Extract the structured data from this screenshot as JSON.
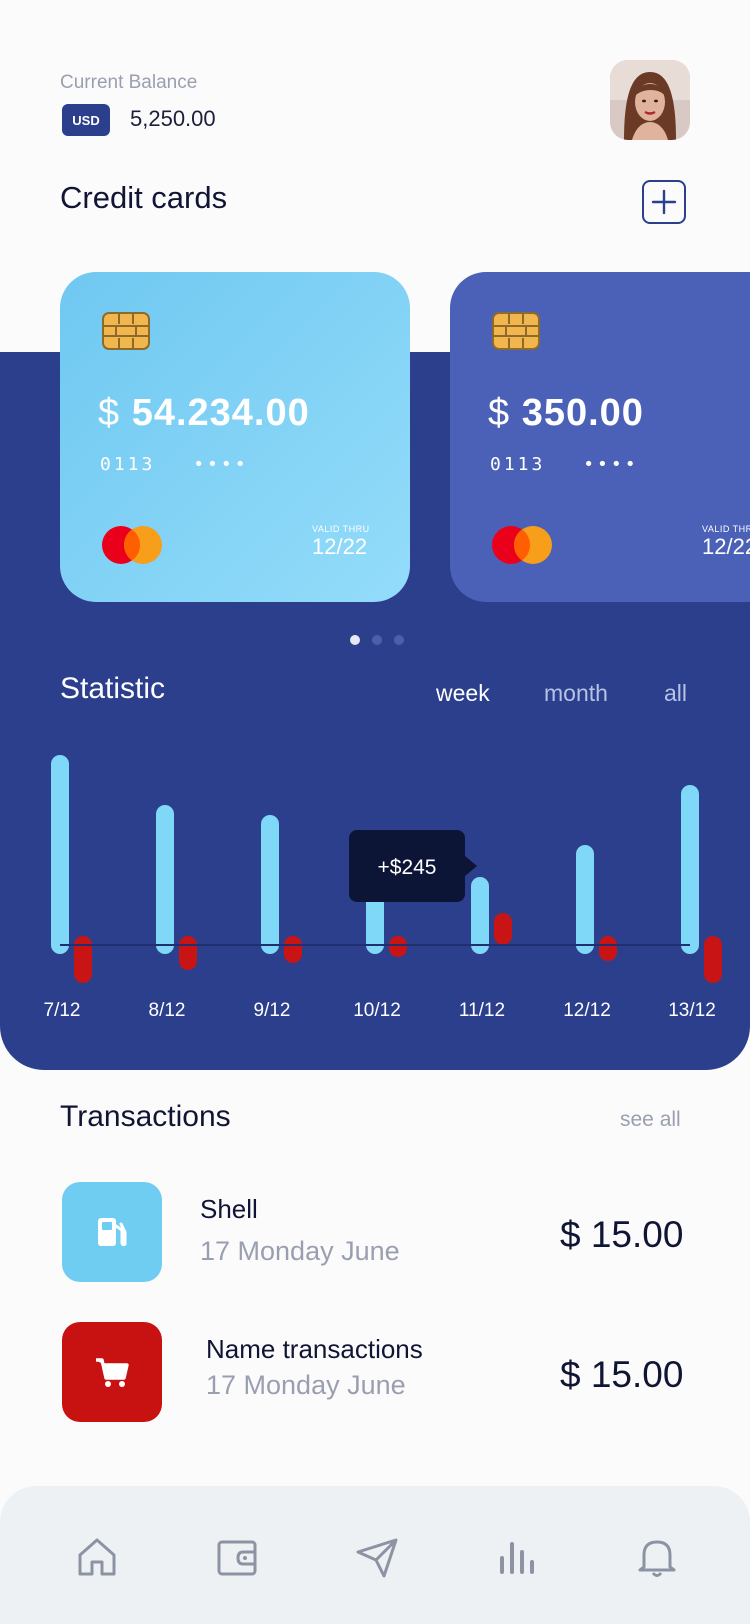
{
  "header": {
    "balance_label": "Current Balance",
    "currency": "USD",
    "balance": "5,250.00"
  },
  "cards_section": {
    "title": "Credit cards",
    "add_icon": "plus-icon"
  },
  "cards": [
    {
      "currency_symbol": "$",
      "amount": "54.234.00",
      "number_prefix": "0113",
      "number_mask": "••••",
      "valid_label": "VALID THRU",
      "valid_date": "12/22",
      "color": "#7ad1f5"
    },
    {
      "currency_symbol": "$",
      "amount": "350.00",
      "number_prefix": "0113",
      "number_mask": "••••",
      "valid_label": "VALID THRU",
      "valid_date": "12/22",
      "color": "#4b61b8"
    }
  ],
  "pagination": {
    "count": 3,
    "active": 0
  },
  "statistic": {
    "title": "Statistic",
    "tabs": [
      "week",
      "month",
      "all"
    ],
    "active_tab": "week",
    "tooltip": "+$245"
  },
  "chart_data": {
    "type": "bar",
    "categories": [
      "7/12",
      "8/12",
      "9/12",
      "10/12",
      "11/12",
      "12/12",
      "13/12"
    ],
    "series": [
      {
        "values": [
          190,
          140,
          130,
          110,
          68,
          100,
          160
        ],
        "color": "#7fd8f7"
      },
      {
        "values": [
          -38,
          -25,
          -18,
          -12,
          32,
          -16,
          -38
        ],
        "color": "#c81414"
      }
    ],
    "colors": {
      "positive": "#7fd8f7",
      "negative": "#c81414",
      "tooltip_bg": "#0c1536"
    }
  },
  "transactions": {
    "title": "Transactions",
    "see_all": "see all",
    "items": [
      {
        "name": "Shell",
        "date": "17 Monday June",
        "amount": "$ 15.00",
        "icon": "fuel-pump-icon",
        "color": "#6fcdf2"
      },
      {
        "name": "Name transactions",
        "date": "17 Monday June",
        "amount": "$ 15.00",
        "icon": "shopping-cart-icon",
        "color": "#c81212"
      }
    ]
  },
  "bottom_nav": {
    "items": [
      "home-icon",
      "wallet-icon",
      "send-icon",
      "statistics-icon",
      "bell-icon"
    ]
  }
}
